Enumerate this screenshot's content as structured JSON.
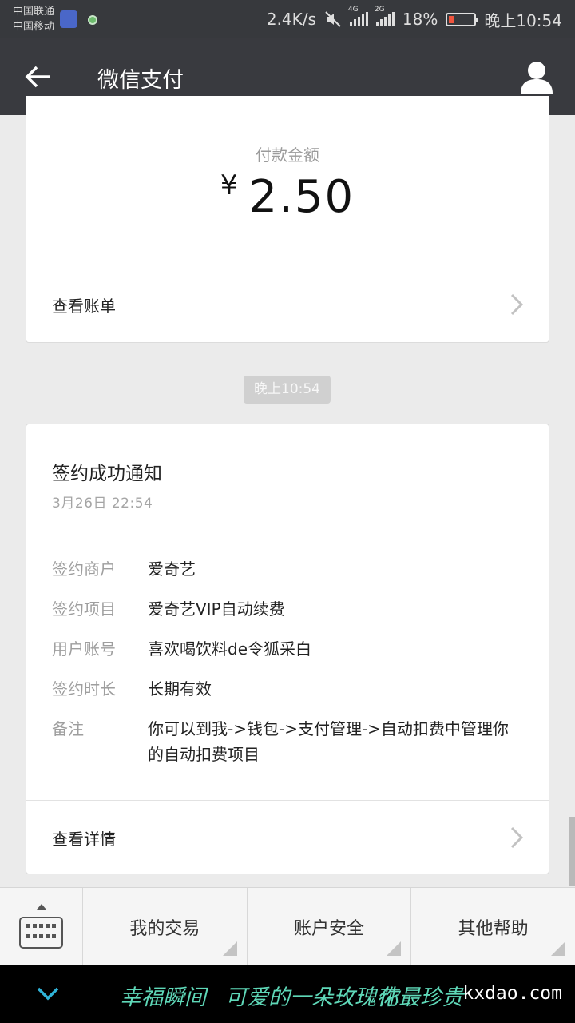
{
  "status_bar": {
    "carrier1": "中国联通",
    "carrier2": "中国移动",
    "speed": "2.4K/s",
    "net1": "4G",
    "net2": "2G",
    "battery": "18%",
    "battery_level": 0.18,
    "time": "晚上10:54",
    "battery_color": "#f0553e"
  },
  "title_bar": {
    "title": "微信支付",
    "back_icon": "back-arrow-icon",
    "user_icon": "user-profile-icon"
  },
  "payment_card": {
    "label": "付款金额",
    "currency": "¥",
    "amount": "2.50",
    "view_bill": "查看账单"
  },
  "time_divider": "晚上10:54",
  "notice_card": {
    "title": "签约成功通知",
    "date": "3月26日  22:54",
    "fields": [
      {
        "key": "签约商户",
        "value": "爱奇艺"
      },
      {
        "key": "签约项目",
        "value": "爱奇艺VIP自动续费"
      },
      {
        "key": "用户账号",
        "value": "喜欢喝饮料de令狐采白"
      },
      {
        "key": "签约时长",
        "value": "长期有效"
      },
      {
        "key": "备注",
        "value": "你可以到我->钱包->支付管理->自动扣费中管理你的自动扣费项目"
      }
    ],
    "view_details": "查看详情"
  },
  "bottom_menu": {
    "keyboard_icon": "keyboard-icon",
    "items": [
      "我的交易",
      "账户安全",
      "其他帮助"
    ]
  },
  "nav_strip": {
    "deco1": "幸福瞬间",
    "deco2": "可爱的一朵玫瑰花",
    "deco3": "你最珍贵",
    "watermark": "kxdao.com"
  }
}
